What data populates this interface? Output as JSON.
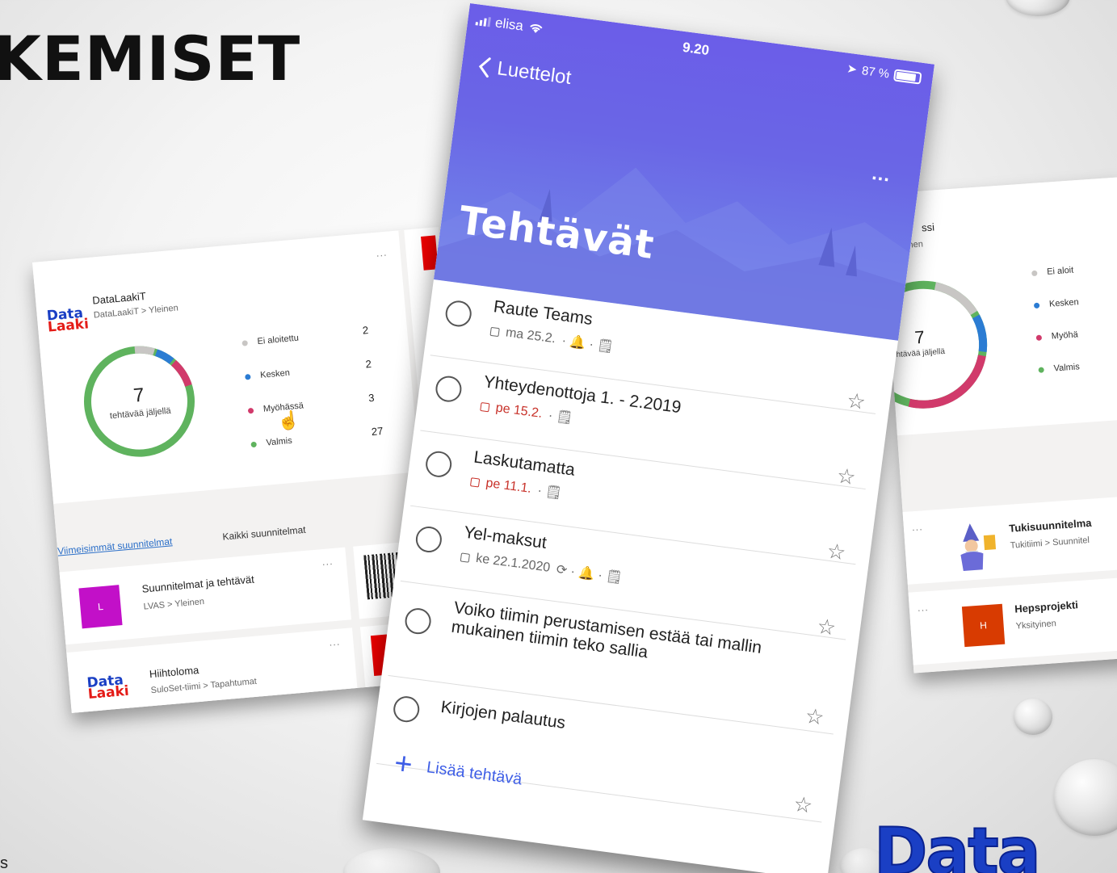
{
  "slide": {
    "title_fragment": "KEMISET",
    "footnote_fragment": "s"
  },
  "planner_left": {
    "hub": {
      "name": "DataLaakiT",
      "path": "DataLaakiT > Yleinen",
      "more": "...",
      "remaining_number": "7",
      "remaining_label": "tehtävää jäljellä"
    },
    "legend": [
      {
        "label": "Ei aloitettu",
        "count": "2",
        "color": "#c8c6c4"
      },
      {
        "label": "Kesken",
        "count": "2",
        "color": "#2b7cd3"
      },
      {
        "label": "Myöhässä",
        "count": "3",
        "color": "#d13a6b"
      },
      {
        "label": "Valmis",
        "count": "27",
        "color": "#5fb35e"
      }
    ],
    "tabs": {
      "recent": "Viimeisimmät suunnitelmat",
      "all": "Kaikki suunnitelmat"
    },
    "plans": [
      {
        "name": "Suunnitelmat ja tehtävät",
        "path": "LVAS > Yleinen",
        "icon_letter": "L",
        "icon_color": "#c210c8",
        "more": "..."
      },
      {
        "name": "Hiihtoloma",
        "path": "SuloSet-tiimi > Tapahtumat",
        "more": "..."
      }
    ],
    "logo_top": "Data",
    "logo_bottom": "Laaki"
  },
  "planner_right": {
    "partial_title": "ssi",
    "partial_sub": "nen",
    "remaining_number": "7",
    "remaining_label": "ehtävää jäljellä",
    "legend": [
      {
        "label": "Ei aloit",
        "color": "#c8c6c4"
      },
      {
        "label": "Kesken",
        "color": "#2b7cd3"
      },
      {
        "label": "Myöhä",
        "color": "#d13a6b"
      },
      {
        "label": "Valmis",
        "color": "#5fb35e"
      }
    ],
    "plans": [
      {
        "name": "Tukisuunnitelma",
        "path": "Tukitiimi > Suunnitel",
        "more": "..."
      },
      {
        "name": "Hepsprojekti",
        "path": "Yksityinen",
        "icon_letter": "H",
        "icon_color": "#d83b01",
        "more": "..."
      }
    ]
  },
  "phone": {
    "status": {
      "carrier": "elisa",
      "time": "9.20",
      "battery": "87 %"
    },
    "back_label": "Luettelot",
    "more": "...",
    "list_title": "Tehtävät",
    "tasks": [
      {
        "title": "Raute Teams",
        "meta": "ma 25.2.",
        "extra": "· 🔔 · 🗒",
        "overdue": false
      },
      {
        "title": "Yhteydenottoja 1. - 2.2019",
        "meta": "pe 15.2.",
        "extra": "· 🗒",
        "overdue": true
      },
      {
        "title": "Laskutamatta",
        "meta": "pe 11.1.",
        "extra": "· 🗒",
        "overdue": true
      },
      {
        "title": "Yel-maksut",
        "meta": "ke 22.1.2020",
        "extra": "⟳ · 🔔 · 🗒",
        "overdue": false
      },
      {
        "title": "Voiko tiimin perustamisen estää tai mallin mukainen tiimin teko sallia",
        "meta": "",
        "extra": "",
        "overdue": false
      },
      {
        "title": "Kirjojen palautus",
        "meta": "",
        "extra": "",
        "overdue": false
      }
    ],
    "add_task": "Lisää tehtävä",
    "accent": "#3e5ee6"
  },
  "corner_logo": "Data"
}
